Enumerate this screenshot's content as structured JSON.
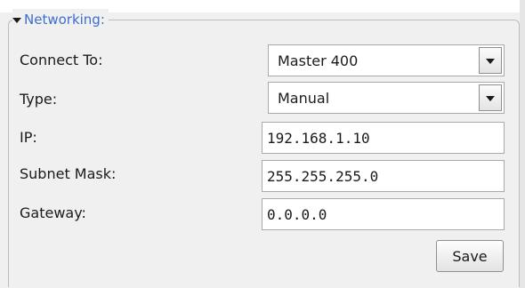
{
  "section": {
    "title": "Networking:"
  },
  "fields": {
    "connect_to": {
      "label": "Connect To:",
      "value": "Master 400"
    },
    "type": {
      "label": "Type:",
      "value": "Manual"
    },
    "ip": {
      "label": "IP:",
      "value": "192.168.1.10"
    },
    "subnet_mask": {
      "label": "Subnet Mask:",
      "value": "255.255.255.0"
    },
    "gateway": {
      "label": "Gateway:",
      "value": "0.0.0.0"
    }
  },
  "actions": {
    "save_label": "Save"
  },
  "colors": {
    "section_title": "#3c6ed4",
    "panel_bg": "#f0f0f0",
    "border": "#a9a9a9"
  },
  "icons": {
    "collapse": "triangle-down-icon",
    "dropdown": "chevron-down-icon"
  }
}
